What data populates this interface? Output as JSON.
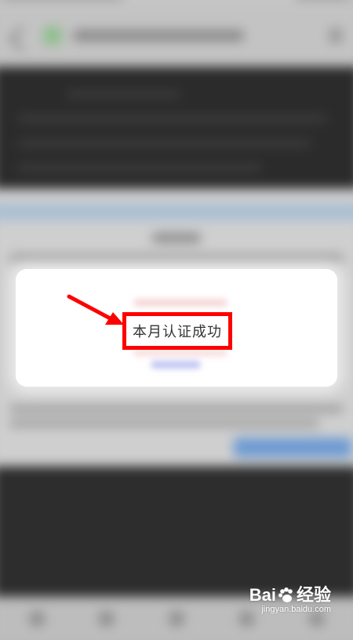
{
  "dialog": {
    "message": "本月认证成功"
  },
  "watermark": {
    "brand_prefix": "Bai",
    "brand_suffix": "经验",
    "url": "jingyan.baidu.com",
    "paw_icon": "paw-icon"
  },
  "colors": {
    "annotation_red": "#ff0000",
    "dialog_bg": "#ffffff",
    "text": "#333333",
    "dark_bg": "#2b2b2b"
  }
}
